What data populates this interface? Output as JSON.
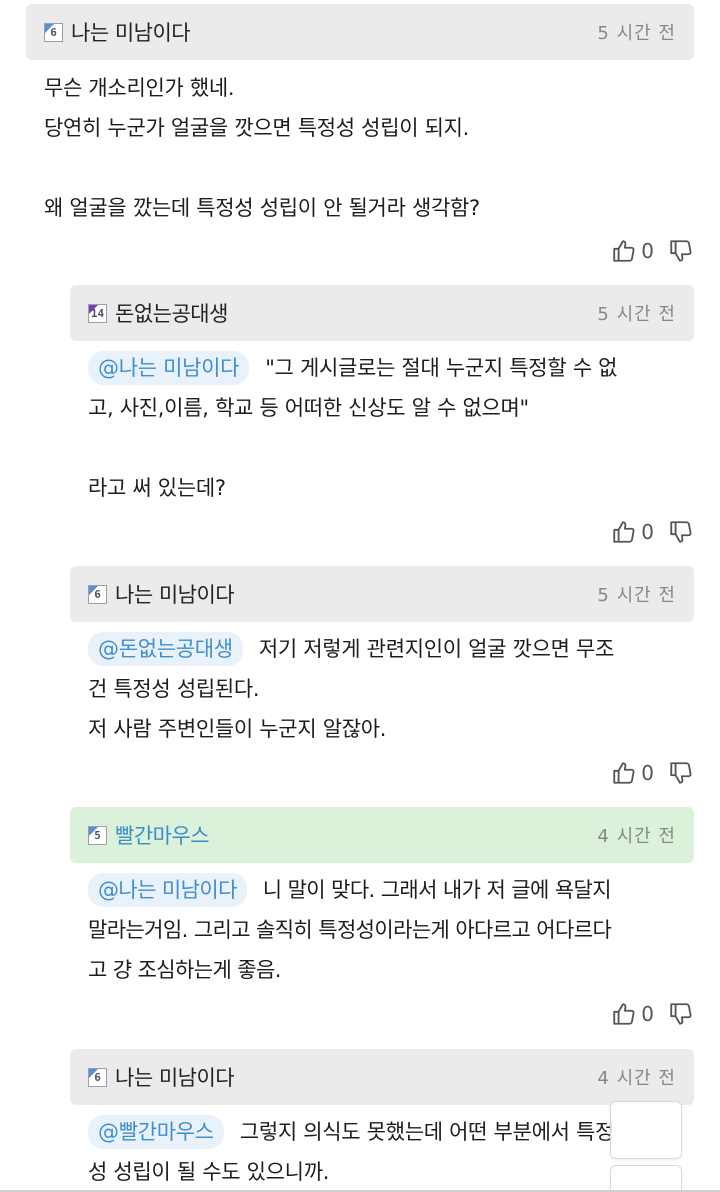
{
  "comments": [
    {
      "author": "나는 미남이다",
      "level": "6",
      "time": "5 시간 전",
      "mention": "",
      "lines": [
        "무슨 개소리인가 했네.",
        "당연히 누군가 얼굴을 깟으면 특정성 성립이 되지.",
        "",
        "왜 얼굴을 깠는데 특정성 성립이 안 될거라 생각함?"
      ],
      "likes": "0"
    },
    {
      "author": "돈없는공대생",
      "level": "14",
      "time": "5 시간 전",
      "mention": "@나는 미남이다",
      "lines": [
        "\"그 게시글로는 절대 누군지 특정할 수 없",
        "고, 사진,이름, 학교 등 어떠한 신상도 알 수 없으며\"",
        "",
        "라고 써 있는데?"
      ],
      "likes": "0"
    },
    {
      "author": "나는 미남이다",
      "level": "6",
      "time": "5 시간 전",
      "mention": "@돈없는공대생",
      "lines": [
        "저기 저렇게 관련지인이 얼굴 깟으면 무조",
        "건 특정성 성립된다.",
        "저 사람 주변인들이 누군지 알잖아."
      ],
      "likes": "0"
    },
    {
      "author": "빨간마우스",
      "level": "5",
      "time": "4 시간 전",
      "mention": "@나는 미남이다",
      "lines": [
        "니 말이 맞다. 그래서 내가 저 글에 욕달지",
        "말라는거임. 그리고 솔직히 특정성이라는게 아다르고 어다르다",
        "고 걍 조심하는게 좋음."
      ],
      "likes": "0"
    },
    {
      "author": "나는 미남이다",
      "level": "6",
      "time": "4 시간 전",
      "mention": "@빨간마우스",
      "lines": [
        "그렇지 의식도 못했는데 어떤 부분에서 특정",
        "성 성립이 될 수도 있으니까."
      ],
      "likes": ""
    }
  ],
  "colors": {
    "header_bg": "#ebebeb",
    "own_header_bg": "#dbf1d9",
    "mention_text": "#3f8fd0",
    "own_author_text": "#3a8ec7"
  },
  "icons": {
    "like": "thumbs-up-icon",
    "dislike": "thumbs-down-icon",
    "level": "level-badge-icon"
  }
}
